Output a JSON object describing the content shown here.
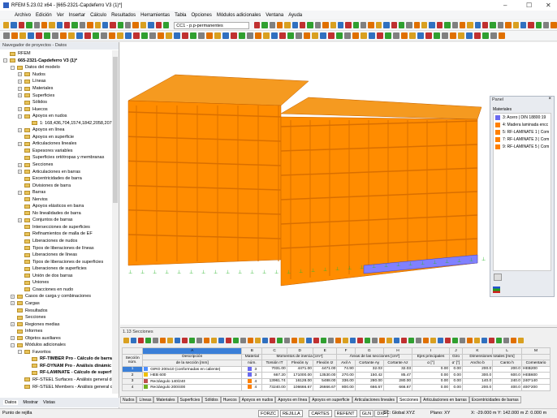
{
  "title": "RFEM 5.23.02 x64 - [665-2321-Capdeferro V3 (1)*]",
  "menu": [
    "Archivo",
    "Edición",
    "Ver",
    "Insertar",
    "Cálculo",
    "Resultados",
    "Herramientas",
    "Tabla",
    "Opciones",
    "Módulos adicionales",
    "Ventana",
    "Ayuda"
  ],
  "load_case": "CC1 - p.p-permanentes",
  "navigator": {
    "title": "Navegador de proyectos - Datos",
    "items": [
      {
        "l": "RFEM",
        "d": 0,
        "e": "n"
      },
      {
        "l": "665-2321-Capdeferro V3 (1)*",
        "d": 0,
        "e": "-",
        "b": true
      },
      {
        "l": "Datos del modelo",
        "d": 1,
        "e": "-"
      },
      {
        "l": "Nudos",
        "d": 2,
        "e": "+"
      },
      {
        "l": "Líneas",
        "d": 2,
        "e": "+"
      },
      {
        "l": "Materiales",
        "d": 2,
        "e": "+"
      },
      {
        "l": "Superficies",
        "d": 2,
        "e": "+"
      },
      {
        "l": "Sólidos",
        "d": 2,
        "e": "n"
      },
      {
        "l": "Huecos",
        "d": 2,
        "e": "+"
      },
      {
        "l": "Apoyos en nudos",
        "d": 2,
        "e": "-"
      },
      {
        "l": "1: 168,436,704,1574,1842,2058,2071,",
        "d": 3,
        "e": "n"
      },
      {
        "l": "Apoyos en línea",
        "d": 2,
        "e": "+"
      },
      {
        "l": "Apoyos en superficie",
        "d": 2,
        "e": "n"
      },
      {
        "l": "Articulaciones lineales",
        "d": 2,
        "e": "+"
      },
      {
        "l": "Espesores variables",
        "d": 2,
        "e": "n"
      },
      {
        "l": "Superficies ortótropas y membranas",
        "d": 2,
        "e": "n"
      },
      {
        "l": "Secciones",
        "d": 2,
        "e": "+"
      },
      {
        "l": "Articulaciones en barras",
        "d": 2,
        "e": "+"
      },
      {
        "l": "Excentricidades de barra",
        "d": 2,
        "e": "n"
      },
      {
        "l": "Divisiones de barra",
        "d": 2,
        "e": "n"
      },
      {
        "l": "Barras",
        "d": 2,
        "e": "+"
      },
      {
        "l": "Nervios",
        "d": 2,
        "e": "n"
      },
      {
        "l": "Apoyos elásticos en barra",
        "d": 2,
        "e": "n"
      },
      {
        "l": "No linealidades de barra",
        "d": 2,
        "e": "n"
      },
      {
        "l": "Conjuntos de barras",
        "d": 2,
        "e": "+"
      },
      {
        "l": "Intersecciones de superficies",
        "d": 2,
        "e": "n"
      },
      {
        "l": "Refinamientos de malla de EF",
        "d": 2,
        "e": "n"
      },
      {
        "l": "Liberaciones de nudos",
        "d": 2,
        "e": "n"
      },
      {
        "l": "Tipos de liberaciones de líneas",
        "d": 2,
        "e": "n"
      },
      {
        "l": "Liberaciones de líneas",
        "d": 2,
        "e": "n"
      },
      {
        "l": "Tipos de liberaciones de superficies",
        "d": 2,
        "e": "n"
      },
      {
        "l": "Liberaciones de superficies",
        "d": 2,
        "e": "n"
      },
      {
        "l": "Unión de dos barras",
        "d": 2,
        "e": "n"
      },
      {
        "l": "Uniones",
        "d": 2,
        "e": "n"
      },
      {
        "l": "Coacciones en nudo",
        "d": 2,
        "e": "n"
      },
      {
        "l": "Casos de carga y combinaciones",
        "d": 1,
        "e": "+"
      },
      {
        "l": "Cargas",
        "d": 1,
        "e": "+"
      },
      {
        "l": "Resultados",
        "d": 1,
        "e": "n"
      },
      {
        "l": "Secciones",
        "d": 1,
        "e": "n"
      },
      {
        "l": "Regiones medias",
        "d": 1,
        "e": "+"
      },
      {
        "l": "Informes",
        "d": 1,
        "e": "n"
      },
      {
        "l": "Objetos auxiliares",
        "d": 1,
        "e": "+"
      },
      {
        "l": "Módulos adicionales",
        "d": 1,
        "e": "-"
      },
      {
        "l": "Favoritos",
        "d": 2,
        "e": "-"
      },
      {
        "l": "RF-TIMBER Pro - Cálculo de barra",
        "d": 3,
        "e": "n",
        "b": true
      },
      {
        "l": "RF-DYNAM Pro - Análisis dinámic",
        "d": 3,
        "e": "n",
        "b": true
      },
      {
        "l": "RF-LAMINATE - Cálculo de superf",
        "d": 3,
        "e": "n",
        "b": true
      },
      {
        "l": "RF-STEEL Surfaces - Análisis general de",
        "d": 2,
        "e": "n"
      },
      {
        "l": "RF-STEEL Members - Análisis general c",
        "d": 2,
        "e": "n"
      }
    ],
    "tabs": [
      "Datos",
      "Mostrar",
      "Vistas"
    ]
  },
  "panel": {
    "title": "Panel",
    "section": "Materiales",
    "materials": [
      {
        "label": "3: Acero | DIN 18800:19",
        "color": "#6a6af0"
      },
      {
        "label": "4: Madera laminada encc",
        "color": "#ff8000"
      },
      {
        "label": "5: RF-LAMINATE 1 | Com",
        "color": "#ff8000"
      },
      {
        "label": "7: RF-LAMINATE 3 | Com",
        "color": "#ff8000"
      },
      {
        "label": "9: RF-LAMINATE 5 | Com",
        "color": "#ff8000"
      }
    ]
  },
  "table": {
    "title": "1.13 Secciones",
    "col_letters": [
      "A",
      "B",
      "C",
      "D",
      "E",
      "F",
      "G",
      "H",
      "I",
      "J",
      "K",
      "L",
      "M"
    ],
    "h1": {
      "sec": "Sección",
      "desc": "Descripción",
      "mat": "Material",
      "mom": "Momentos de inercia [cm⁴]",
      "areas": "Áreas de las secciones [cm²]",
      "ejes": "Ejes principales",
      "giro": "Giro",
      "dim": "Dimensiones totales [mm]"
    },
    "h2": {
      "sec": "núm.",
      "desc": "de la sección [mm]",
      "mat": "núm.",
      "c": "Torsión IT",
      "d": "Flexión Iy",
      "e": "Flexión Iz",
      "f": "Axil A",
      "g": "Cortante Ay",
      "h": "Cortante Az",
      "i": "α [°]",
      "j": "α' [°]",
      "k": "Ancho b",
      "l": "Canto h",
      "m": "Comentario"
    },
    "rows": [
      {
        "n": "1",
        "color": "#4f8fff",
        "desc": "GIRO 200x10 (conformadas en caliente)",
        "mat": "3",
        "matc": "#6a6af0",
        "c": "7031.00",
        "d": "4471.00",
        "e": "4471.00",
        "f": "74.90",
        "g": "32.03",
        "h": "32.03",
        "i": "0.00",
        "j": "0.00",
        "k": "200.0",
        "l": "200.0",
        "m": "HEB200"
      },
      {
        "n": "2",
        "color": "#f0c000",
        "desc": "HEB 600",
        "mat": "3",
        "matc": "#6a6af0",
        "c": "667.20",
        "d": "171000.00",
        "e": "13530.00",
        "f": "270.00",
        "g": "150.42",
        "h": "85.47",
        "i": "0.00",
        "j": "0.00",
        "k": "300.0",
        "l": "600.0",
        "m": "HEB600"
      },
      {
        "n": "3",
        "color": "#c05050",
        "desc": "Rectángulo 140/240",
        "mat": "4",
        "matc": "#ff8000",
        "c": "13961.74",
        "d": "16128.00",
        "e": "5488.00",
        "f": "336.00",
        "g": "280.00",
        "h": "280.00",
        "i": "0.00",
        "j": "0.00",
        "k": "140.0",
        "l": "240.0",
        "m": "240*140"
      },
      {
        "n": "4",
        "color": "#70b020",
        "desc": "Rectángulo 200/400",
        "mat": "4",
        "matc": "#ff8000",
        "c": "73240.00",
        "d": "106666.67",
        "e": "26666.67",
        "f": "800.00",
        "g": "666.67",
        "h": "666.67",
        "i": "0.00",
        "j": "0.00",
        "k": "200.0",
        "l": "400.0",
        "m": "400*200"
      }
    ]
  },
  "bottom_tabs": [
    "Nudos",
    "Líneas",
    "Materiales",
    "Superficies",
    "Sólidos",
    "Huecos",
    "Apoyos en nudos",
    "Apoyos en línea",
    "Apoyos en superficie",
    "Articulaciones lineales",
    "Secciones",
    "Articulaciones en barras",
    "Excentricidades de barras"
  ],
  "active_bottom_tab": "Secciones",
  "status": {
    "left": "Punto de rejilla",
    "toggles": [
      "FORZC",
      "REJILLA",
      "CARTES",
      "REFENT",
      "GLN",
      "DXF"
    ],
    "sc": "SC: Global XYZ",
    "plane": "Plano: XY",
    "coords": "X: -29.000 m   Y: 142.000 m   Z: 0.000 m"
  },
  "colors": {
    "building": "#ff8c00",
    "building_dark": "#d96f00",
    "support": "#2db82d"
  }
}
